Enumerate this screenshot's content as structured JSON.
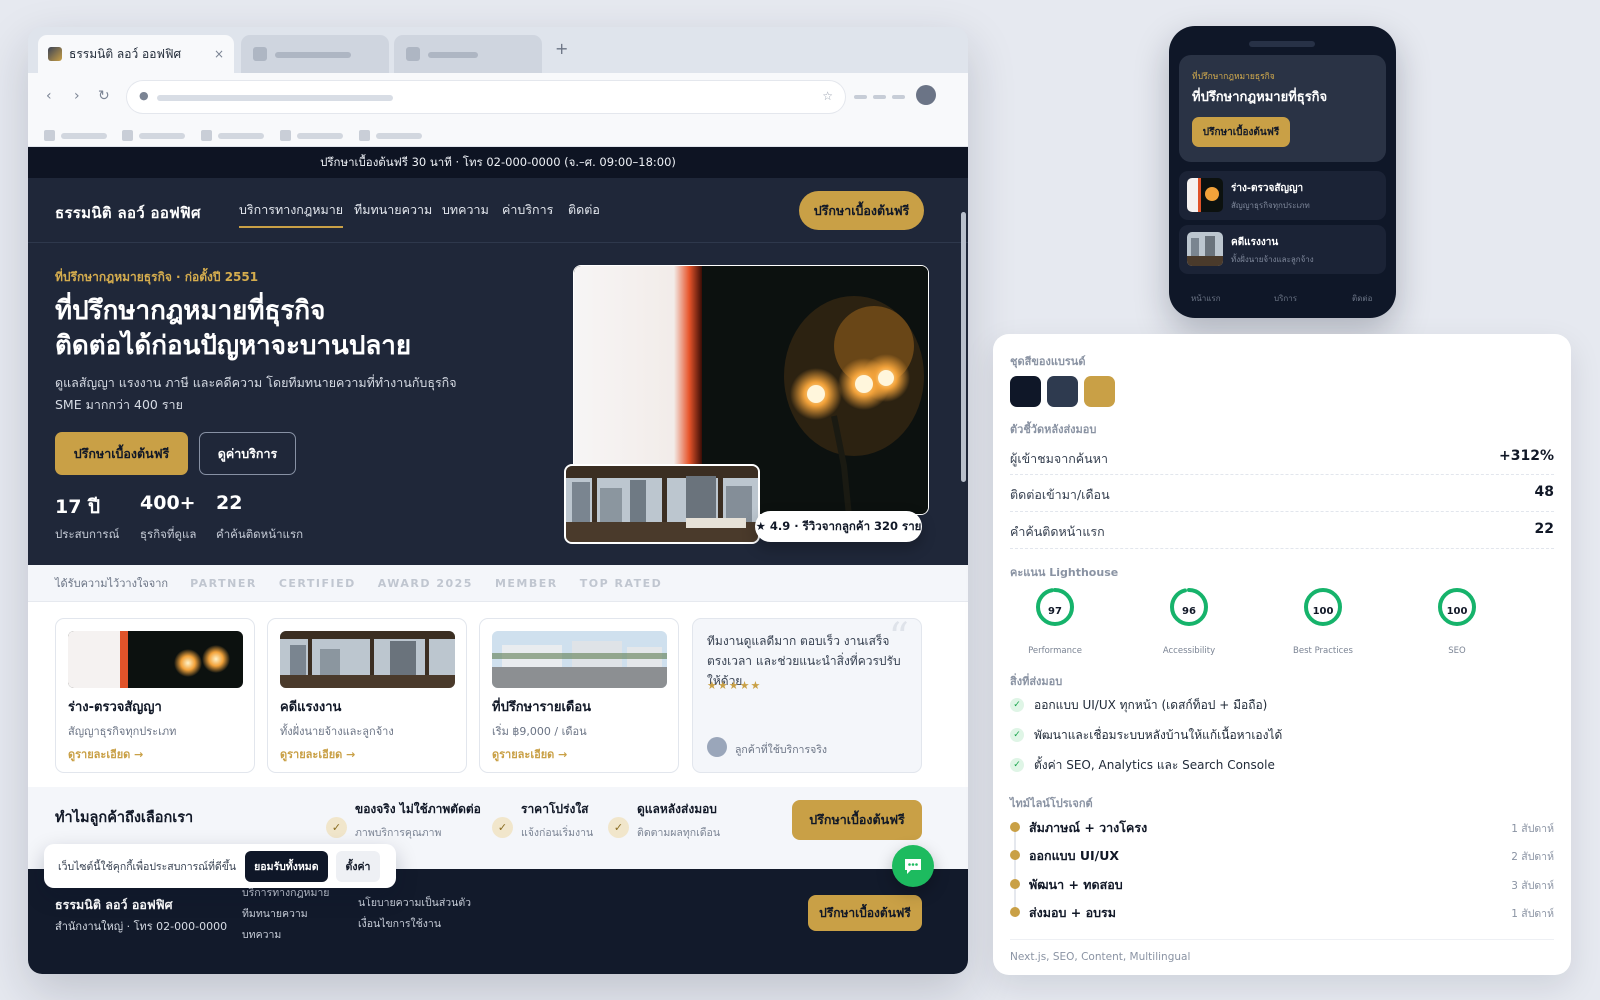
{
  "browser": {
    "tab_title": "ธรรมนิติ ลอว์ ออฟฟิศ",
    "tab_close": "×",
    "new_tab": "+"
  },
  "site": {
    "topbar": "ปรึกษาเบื้องต้นฟรี 30 นาที · โทร 02-000-0000 (จ.–ศ. 09:00–18:00)",
    "brand": "ธรรมนิติ ลอว์ ออฟฟิศ",
    "nav": [
      "บริการทางกฎหมาย",
      "ทีมทนายความ",
      "บทความ",
      "ค่าบริการ",
      "ติดต่อ"
    ],
    "nav_cta": "ปรึกษาเบื้องต้นฟรี",
    "eyebrow": "ที่ปรึกษากฎหมายธุรกิจ · ก่อตั้งปี 2551",
    "headline_1": "ที่ปรึกษากฎหมายที่ธุรกิจ",
    "headline_2": "ติดต่อได้ก่อนปัญหาจะบานปลาย",
    "subtext": "ดูแลสัญญา แรงงาน ภาษี และคดีความ โดยทีมทนายความที่ทำงานกับธุรกิจ SME มากกว่า 400 ราย",
    "cta_primary": "ปรึกษาเบื้องต้นฟรี",
    "cta_secondary": "ดูค่าบริการ",
    "stats": [
      {
        "value": "17 ปี",
        "label": "ประสบการณ์"
      },
      {
        "value": "400+",
        "label": "ธุรกิจที่ดูแล"
      },
      {
        "value": "22",
        "label": "คำค้นติดหน้าแรก"
      }
    ],
    "rating": "★ 4.9 · รีวิวจากลูกค้า 320 ราย",
    "trust_label": "ได้รับความไว้วางใจจาก",
    "trust_logos": [
      "PARTNER",
      "CERTIFIED",
      "AWARD 2025",
      "MEMBER",
      "TOP RATED"
    ],
    "cards": [
      {
        "title": "ร่าง-ตรวจสัญญา",
        "desc": "สัญญาธุรกิจทุกประเภท",
        "link": "ดูรายละเอียด →"
      },
      {
        "title": "คดีแรงงาน",
        "desc": "ทั้งฝั่งนายจ้างและลูกจ้าง",
        "link": "ดูรายละเอียด →"
      },
      {
        "title": "ที่ปรึกษารายเดือน",
        "desc": "เริ่ม ฿9,000 / เดือน",
        "link": "ดูรายละเอียด →"
      }
    ],
    "testimonial": {
      "text": "ทีมงานดูแลดีมาก ตอบเร็ว งานเสร็จตรงเวลา และช่วยแนะนำสิ่งที่ควรปรับให้ด้วย",
      "stars": "★★★★★",
      "author": "ลูกค้าที่ใช้บริการจริง"
    },
    "why_heading": "ทำไมลูกค้าถึงเลือกเรา",
    "features": [
      {
        "title": "ของจริง ไม่ใช้ภาพตัดต่อ",
        "desc": "ภาพบริการคุณภาพ"
      },
      {
        "title": "ราคาโปร่งใส",
        "desc": "แจ้งก่อนเริ่มงาน"
      },
      {
        "title": "ดูแลหลังส่งมอบ",
        "desc": "ติดตามผลทุกเดือน"
      }
    ],
    "feature_check": "✓",
    "why_cta": "ปรึกษาเบื้องต้นฟรี",
    "footer": {
      "brand": "ธรรมนิติ ลอว์ ออฟฟิศ",
      "address": "สำนักงานใหญ่ · โทร 02-000-0000",
      "links_col1": [
        "บริการทางกฎหมาย",
        "ทีมทนายความ",
        "บทความ"
      ],
      "links_col2": [
        "นโยบายความเป็นส่วนตัว",
        "เงื่อนไขการใช้งาน"
      ],
      "cta": "ปรึกษาเบื้องต้นฟรี"
    },
    "cookie": {
      "text": "เว็บไซต์นี้ใช้คุกกี้เพื่อประสบการณ์ที่ดีขึ้น",
      "accept": "ยอมรับทั้งหมด",
      "settings": "ตั้งค่า"
    }
  },
  "mobile": {
    "eyebrow": "ที่ปรึกษากฎหมายธุรกิจ",
    "headline": "ที่ปรึกษากฎหมายที่ธุรกิจ",
    "cta": "ปรึกษาเบื้องต้นฟรี",
    "items": [
      {
        "title": "ร่าง-ตรวจสัญญา",
        "desc": "สัญญาธุรกิจทุกประเภท"
      },
      {
        "title": "คดีแรงงาน",
        "desc": "ทั้งฝั่งนายจ้างและลูกจ้าง"
      }
    ],
    "tabs": [
      "หน้าแรก",
      "บริการ",
      "ติดต่อ"
    ]
  },
  "panel": {
    "brand_colors_label": "ชุดสีของแบรนด์",
    "brand_colors": [
      "#0f1728",
      "#2e3a4f",
      "#c9a046"
    ],
    "kpi_label": "ตัวชี้วัดหลังส่งมอบ",
    "kpis": [
      {
        "label": "ผู้เข้าชมจากค้นหา",
        "value": "+312%"
      },
      {
        "label": "ติดต่อเข้ามา/เดือน",
        "value": "48"
      },
      {
        "label": "คำค้นติดหน้าแรก",
        "value": "22"
      }
    ],
    "lighthouse_label": "คะแนน Lighthouse",
    "lighthouse": [
      {
        "score": 97,
        "label": "Performance"
      },
      {
        "score": 96,
        "label": "Accessibility"
      },
      {
        "score": 100,
        "label": "Best Practices"
      },
      {
        "score": 100,
        "label": "SEO"
      }
    ],
    "deliverables_label": "สิ่งที่ส่งมอบ",
    "deliverables": [
      "ออกแบบ UI/UX ทุกหน้า (เดสก์ท็อป + มือถือ)",
      "พัฒนาและเชื่อมระบบหลังบ้านให้แก้เนื้อหาเองได้",
      "ตั้งค่า SEO, Analytics และ Search Console"
    ],
    "check": "✓",
    "timeline_label": "ไทม์ไลน์โปรเจกต์",
    "timeline": [
      {
        "step": "สัมภาษณ์ + วางโครง",
        "duration": "1 สัปดาห์"
      },
      {
        "step": "ออกแบบ UI/UX",
        "duration": "2 สัปดาห์"
      },
      {
        "step": "พัฒนา + ทดสอบ",
        "duration": "3 สัปดาห์"
      },
      {
        "step": "ส่งมอบ + อบรม",
        "duration": "1 สัปดาห์"
      }
    ],
    "tech": "Next.js, SEO, Content, Multilingual"
  }
}
